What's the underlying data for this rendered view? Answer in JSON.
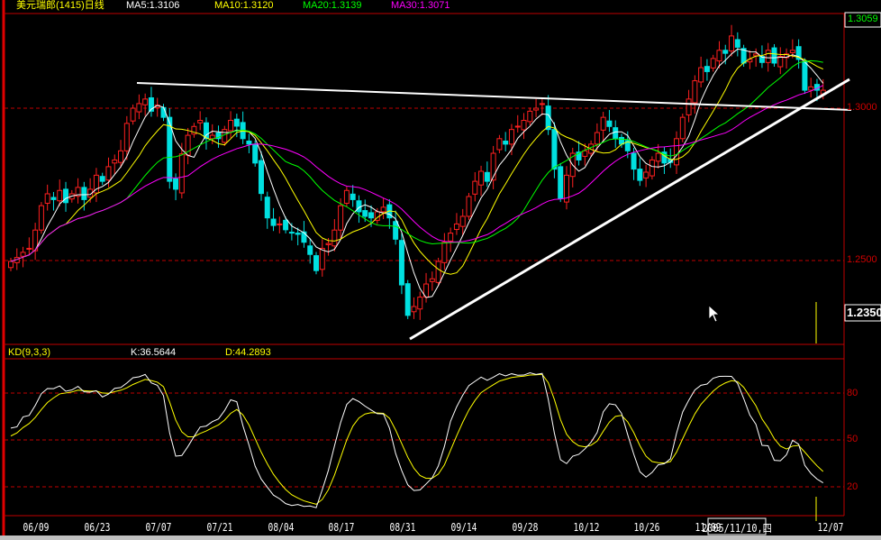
{
  "header": {
    "title": "美元瑞郎(1415)日线",
    "ma5": "MA5:1.3106",
    "ma10": "MA10:1.3120",
    "ma20": "MA20:1.3139",
    "ma30": "MA30:1.3071"
  },
  "price_axis": {
    "current_price": "1.3059",
    "level_1": "1.3000",
    "level_2": "1.2500",
    "cursor_price": "1.2350"
  },
  "kd_header": {
    "title": "KD(9,3,3)",
    "k": "K:36.5644",
    "d": "D:44.2893"
  },
  "kd_axis": [
    "80",
    "50",
    "20"
  ],
  "dates": [
    "06/09",
    "06/23",
    "07/07",
    "07/21",
    "08/04",
    "08/17",
    "08/31",
    "09/14",
    "09/28",
    "10/12",
    "10/26",
    "11/09",
    "12/07"
  ],
  "cursor_date": "2005/11/10,四",
  "colors": {
    "up": "#ff2020",
    "down": "#00e0e0",
    "ma5": "#ffffff",
    "ma10": "#ffff00",
    "ma20": "#00ff00",
    "ma30": "#ff00ff",
    "grid": "#c00000",
    "k": "#ffffff",
    "d": "#ffff00"
  },
  "chart_data": {
    "type": "candlestick",
    "title": "美元瑞郎(1415)日线",
    "date_ticks": [
      "06/09",
      "06/23",
      "07/07",
      "07/21",
      "08/04",
      "08/17",
      "08/31",
      "09/14",
      "09/28",
      "10/12",
      "10/26",
      "11/09",
      "12/07"
    ],
    "price_gridlines": [
      1.3,
      1.25
    ],
    "closes": [
      1.2497,
      1.251,
      1.2527,
      1.254,
      1.26,
      1.268,
      1.2719,
      1.27,
      1.273,
      1.269,
      1.2719,
      1.274,
      1.27,
      1.2734,
      1.278,
      1.276,
      1.2808,
      1.283,
      1.286,
      1.295,
      1.3,
      1.3015,
      1.303,
      1.299,
      1.301,
      1.297,
      1.276,
      1.2734,
      1.285,
      1.2911,
      1.294,
      1.296,
      1.29,
      1.2911,
      1.29,
      1.293,
      1.296,
      1.2941,
      1.29,
      1.2882,
      1.282,
      1.272,
      1.264,
      1.2615,
      1.262,
      1.2601,
      1.259,
      1.2586,
      1.256,
      1.252,
      1.2467,
      1.254,
      1.2556,
      1.26,
      1.268,
      1.273,
      1.27,
      1.266,
      1.2645,
      1.264,
      1.266,
      1.2675,
      1.264,
      1.257,
      1.242,
      1.232,
      1.2349,
      1.238,
      1.2423,
      1.244,
      1.2497,
      1.256,
      1.259,
      1.262,
      1.2645,
      1.271,
      1.276,
      1.2793,
      1.276,
      1.2852,
      1.29,
      1.2882,
      1.293,
      1.2941,
      1.296,
      1.299,
      1.3,
      1.3015,
      1.293,
      1.28,
      1.2704,
      1.278,
      1.2852,
      1.283,
      1.286,
      1.2882,
      1.292,
      1.297,
      1.294,
      1.29,
      1.2882,
      1.286,
      1.28,
      1.2763,
      1.279,
      1.283,
      1.2852,
      1.282,
      1.2822,
      1.29,
      1.297,
      1.303,
      1.309,
      1.3133,
      1.312,
      1.3163,
      1.319,
      1.318,
      1.3237,
      1.32,
      1.3148,
      1.316,
      1.3178,
      1.315,
      1.319,
      1.3148,
      1.317,
      1.3178,
      1.319,
      1.316,
      1.3059,
      1.307,
      1.3059,
      1.3059
    ],
    "indicators": [
      "MA5",
      "MA10",
      "MA20",
      "MA30",
      "KD(9,3,3)"
    ]
  }
}
